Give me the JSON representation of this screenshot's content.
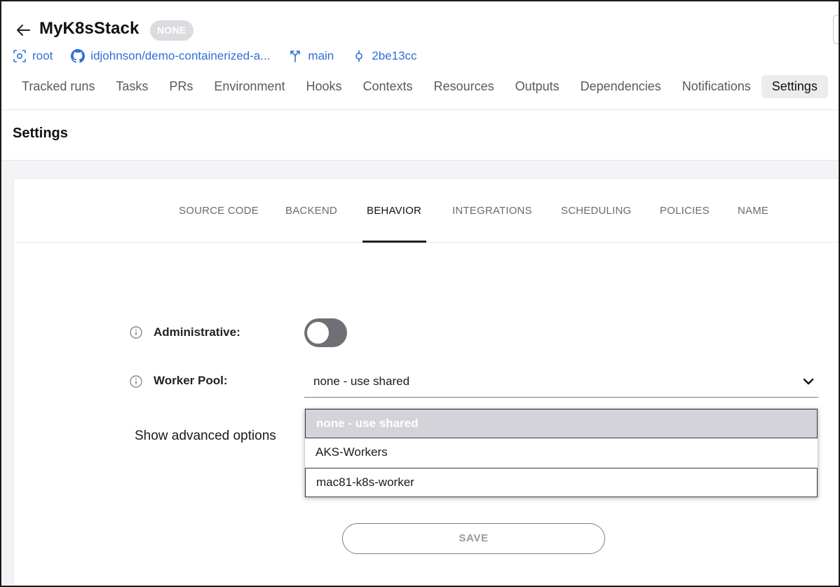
{
  "header": {
    "title": "MyK8sStack",
    "state_badge": "NONE",
    "space": "root",
    "repository": "idjohnson/demo-containerized-a...",
    "branch": "main",
    "commit": "2be13cc"
  },
  "tabs": [
    {
      "label": "Tracked runs"
    },
    {
      "label": "Tasks"
    },
    {
      "label": "PRs"
    },
    {
      "label": "Environment"
    },
    {
      "label": "Hooks"
    },
    {
      "label": "Contexts"
    },
    {
      "label": "Resources"
    },
    {
      "label": "Outputs"
    },
    {
      "label": "Dependencies"
    },
    {
      "label": "Notifications"
    },
    {
      "label": "Settings",
      "active": true
    }
  ],
  "page_title": "Settings",
  "settings_tabs": [
    {
      "label": "SOURCE CODE"
    },
    {
      "label": "BACKEND"
    },
    {
      "label": "BEHAVIOR",
      "active": true
    },
    {
      "label": "INTEGRATIONS"
    },
    {
      "label": "SCHEDULING"
    },
    {
      "label": "POLICIES"
    },
    {
      "label": "NAME"
    }
  ],
  "form": {
    "administrative_label": "Administrative:",
    "administrative_on": false,
    "worker_pool_label": "Worker Pool:",
    "worker_pool_value": "none - use shared",
    "worker_pool_options": [
      "none - use shared",
      "AKS-Workers",
      "mac81-k8s-worker"
    ],
    "show_advanced": "Show advanced options",
    "save_label": "SAVE"
  },
  "colors": {
    "link": "#2f6fd6",
    "toggle_off": "#6f6f76",
    "badge": "#dcdce0",
    "selected_option": "#d3d3d9"
  }
}
